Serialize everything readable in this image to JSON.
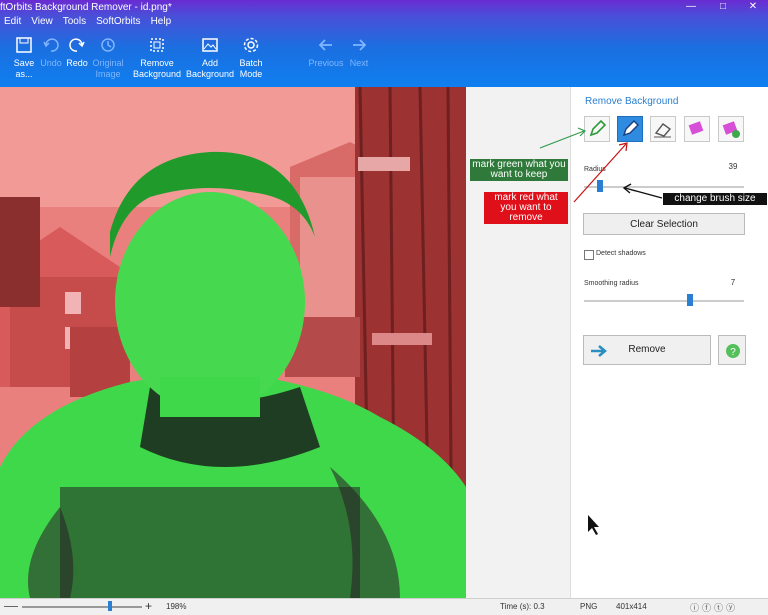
{
  "window": {
    "title": "ftOrbits Background Remover - id.png*"
  },
  "menu": [
    "Edit",
    "View",
    "Tools",
    "SoftOrbits",
    "Help"
  ],
  "toolbar": {
    "save_as": "Save as...",
    "undo": "Undo",
    "redo": "Redo",
    "original_image": "Original Image",
    "remove_background": "Remove Background",
    "add_background": "Add Background",
    "batch_mode": "Batch Mode",
    "previous": "Previous",
    "next": "Next"
  },
  "panel": {
    "title": "Remove Background",
    "radius_label": "Radius",
    "radius_value": "39",
    "radius_level": 0.1,
    "clear_selection": "Clear Selection",
    "detect_shadows": "Detect shadows",
    "detect_shadows_checked": false,
    "smoothing_label": "Smoothing radius",
    "smoothing_value": "7",
    "smoothing_level": 0.66,
    "remove_label": "Remove"
  },
  "annotations": {
    "green": "mark green what you want to keep",
    "red": "mark red what you want to remove",
    "brush": "change brush size"
  },
  "status": {
    "zoom": "198%",
    "time": "Time (s): 0.3",
    "format": "PNG",
    "size": "401x414"
  },
  "colors": {
    "keep": "#3fd84a",
    "remove": "#e05a5a",
    "accent": "#2a7fd0",
    "ribbon": "#1b6fe0"
  }
}
